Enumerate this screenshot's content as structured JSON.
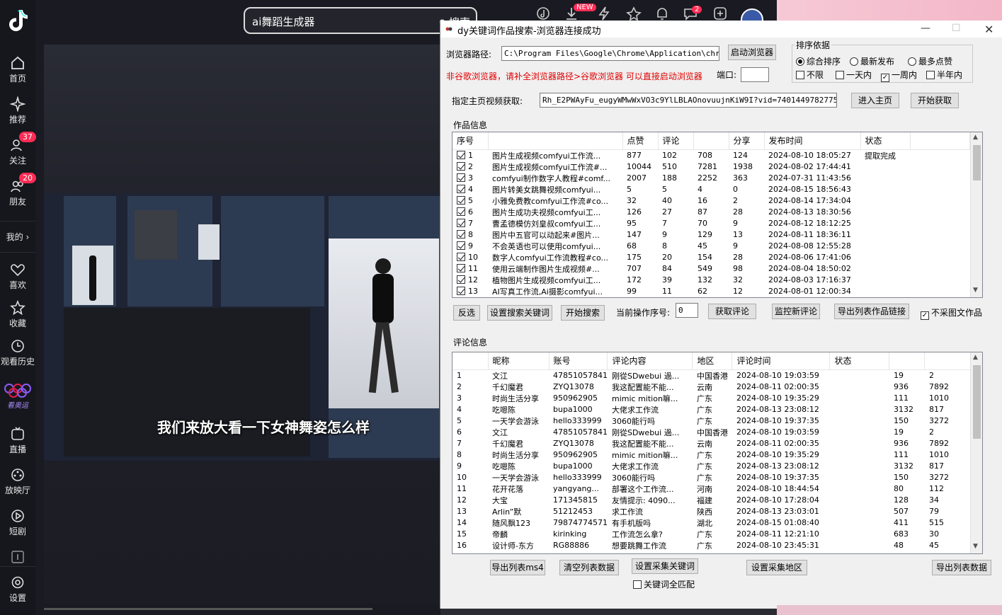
{
  "sidebar": {
    "items": [
      {
        "label": "首页"
      },
      {
        "label": "推荐"
      },
      {
        "label": "关注",
        "badge": "37"
      },
      {
        "label": "朋友",
        "badge": "20"
      },
      {
        "label": "我的 ›"
      },
      {
        "label": "喜欢"
      },
      {
        "label": "收藏"
      },
      {
        "label": "观看历史"
      },
      {
        "label": "看奥运"
      },
      {
        "label": "直播"
      },
      {
        "label": "放映厅"
      },
      {
        "label": "短剧"
      },
      {
        "label": "设置"
      }
    ]
  },
  "topbar": {
    "search_value": "ai舞蹈生成器",
    "search_button": "搜索",
    "download_badge": "NEW",
    "message_badge": "2"
  },
  "video": {
    "subtitle": "我们来放大看一下女神舞姿怎么样"
  },
  "window": {
    "title": "dy关键词作品搜索-浏览器连接成功",
    "browser_path_label": "浏览器路径:",
    "browser_path_value": "C:\\Program Files\\Google\\Chrome\\Application\\chrome.e",
    "launch_browser_button": "启动浏览器",
    "red_note": "非谷歌浏览器，请补全浏览器路径>谷歌浏览器 可以直接启动浏览器",
    "port_label": "端口:",
    "port_value": "",
    "sort_group_label": "排序依据",
    "sort_options": [
      {
        "label": "综合排序",
        "checked": true
      },
      {
        "label": "最新发布",
        "checked": false
      },
      {
        "label": "最多点赞",
        "checked": false
      }
    ],
    "time_options": [
      {
        "label": "不限",
        "checked": false
      },
      {
        "label": "一天内",
        "checked": false
      },
      {
        "label": "一周内",
        "checked": true
      },
      {
        "label": "半年内",
        "checked": false
      }
    ],
    "homepage_label": "指定主页视频获取:",
    "homepage_value": "Rh_E2PWAyFu_eugyWMwWxVO3c9YlLBLAOnovuujnKiW9I?vid=7401449782775958784",
    "enter_home_button": "进入主页",
    "start_fetch_button": "开始获取",
    "works_group_label": "作品信息",
    "works_columns": [
      "序号",
      "",
      "点赞",
      "评论",
      "",
      "分享",
      "发布时间",
      "状态",
      ""
    ],
    "works_rows": [
      [
        "1",
        "图片生成视频comfyui工作流...",
        "877",
        "102",
        "708",
        "124",
        "2024-08-10 18:05:27",
        "提取完成"
      ],
      [
        "2",
        "图片生成视频comfyui工作流#...",
        "10044",
        "510",
        "7281",
        "1938",
        "2024-08-02 17:44:41",
        ""
      ],
      [
        "3",
        "comfyui制作数字人教程#comf...",
        "2007",
        "188",
        "2252",
        "363",
        "2024-07-31 11:43:56",
        ""
      ],
      [
        "4",
        "图片转美女跳舞视频comfyui...",
        "5",
        "5",
        "4",
        "0",
        "2024-08-15 18:56:43",
        ""
      ],
      [
        "5",
        "小雅免费教comfyui工作流#co...",
        "32",
        "40",
        "16",
        "2",
        "2024-08-14 17:34:04",
        ""
      ],
      [
        "6",
        "图片生成功夫视频comfyui工...",
        "126",
        "27",
        "87",
        "28",
        "2024-08-13 18:30:56",
        ""
      ],
      [
        "7",
        "曹孟德模仿刘皇叔comfyui工...",
        "95",
        "7",
        "70",
        "9",
        "2024-08-12 18:12:25",
        ""
      ],
      [
        "8",
        "图片中五官可以动起来#图片...",
        "147",
        "9",
        "129",
        "13",
        "2024-08-11 18:36:11",
        ""
      ],
      [
        "9",
        "不会英语也可以使用comfyui...",
        "68",
        "8",
        "45",
        "9",
        "2024-08-08 12:55:28",
        ""
      ],
      [
        "10",
        "数字人comfyui工作流教程#co...",
        "175",
        "20",
        "154",
        "28",
        "2024-08-06 17:41:06",
        ""
      ],
      [
        "11",
        "使用云端制作图片生成视频#...",
        "707",
        "84",
        "549",
        "98",
        "2024-08-04 18:50:02",
        ""
      ],
      [
        "12",
        "植物图片生成视频comfyui工...",
        "172",
        "39",
        "132",
        "32",
        "2024-08-03 17:16:37",
        ""
      ],
      [
        "13",
        "AI写真工作流,Ai摄影comfyui...",
        "99",
        "11",
        "62",
        "12",
        "2024-08-01 12:00:34",
        ""
      ]
    ],
    "invert_button": "反选",
    "set_keyword_button": "设置搜索关键词",
    "start_search_button": "开始搜索",
    "current_index_label": "当前操作序号:",
    "current_index_value": "0",
    "get_comments_button": "获取评论",
    "monitor_button": "监控新评论",
    "export_links_button": "导出列表作品链接",
    "no_image_check_label": "不采图文作品",
    "comments_group_label": "评论信息",
    "comments_columns": [
      "",
      "昵称",
      "账号",
      "评论内容",
      "地区",
      "评论时间",
      "状态",
      "",
      ""
    ],
    "comments_rows": [
      [
        "1",
        "文江",
        "47851057841",
        "刚從SDwebui 過...",
        "中国香港",
        "2024-08-10 19:03:59",
        "",
        "19",
        "2"
      ],
      [
        "2",
        "千幻魔君",
        "ZYQ13078",
        "我这配置能不能...",
        "云南",
        "2024-08-11 02:00:35",
        "",
        "936",
        "7892"
      ],
      [
        "3",
        "时尚生活分享",
        "950962905",
        "mimic mition嘛...",
        "广东",
        "2024-08-10 19:35:29",
        "",
        "111",
        "1010"
      ],
      [
        "4",
        "吃嗯陈",
        "bupa1000",
        "大佬求工作流",
        "广东",
        "2024-08-13 23:08:12",
        "",
        "3132",
        "817"
      ],
      [
        "5",
        "一天学会游泳",
        "hello333999",
        "3060能行吗",
        "广东",
        "2024-08-10 19:37:35",
        "",
        "150",
        "3272"
      ],
      [
        "6",
        "文江",
        "47851057841",
        "刚從SDwebui 過...",
        "中国香港",
        "2024-08-10 19:03:59",
        "",
        "19",
        "2"
      ],
      [
        "7",
        "千幻魔君",
        "ZYQ13078",
        "我这配置能不能...",
        "云南",
        "2024-08-11 02:00:35",
        "",
        "936",
        "7892"
      ],
      [
        "8",
        "时尚生活分享",
        "950962905",
        "mimic mition嘛...",
        "广东",
        "2024-08-10 19:35:29",
        "",
        "111",
        "1010"
      ],
      [
        "9",
        "吃嗯陈",
        "bupa1000",
        "大佬求工作流",
        "广东",
        "2024-08-13 23:08:12",
        "",
        "3132",
        "817"
      ],
      [
        "10",
        "一天学会游泳",
        "hello333999",
        "3060能行吗",
        "广东",
        "2024-08-10 19:37:35",
        "",
        "150",
        "3272"
      ],
      [
        "11",
        "花开花落",
        "yangyang...",
        "部署这个工作流...",
        "河南",
        "2024-08-10 18:44:54",
        "",
        "80",
        "112"
      ],
      [
        "12",
        "大宝",
        "171345815",
        "友情提示: 4090...",
        "福建",
        "2024-08-10 17:28:04",
        "",
        "128",
        "34"
      ],
      [
        "13",
        "Arlin”默",
        "51212453",
        "求工作流",
        "陕西",
        "2024-08-13 23:03:01",
        "",
        "507",
        "79"
      ],
      [
        "14",
        "随风飘123",
        "79874774571",
        "有手机版吗",
        "湖北",
        "2024-08-15 01:08:40",
        "",
        "411",
        "515"
      ],
      [
        "15",
        "帝麟",
        "kirinking",
        "工作流怎么拿?",
        "广东",
        "2024-08-11 12:21:10",
        "",
        "683",
        "30"
      ],
      [
        "16",
        "设计师-东方",
        "RG88886",
        "想要跳舞工作流",
        "广东",
        "2024-08-10 23:45:31",
        "",
        "48",
        "45"
      ]
    ],
    "export_ms4_button": "导出列表ms4",
    "clear_list_button": "清空列表数据",
    "set_collect_keyword_button": "设置采集关键词",
    "set_region_button": "设置采集地区",
    "export_list_button": "导出列表数据",
    "keyword_match_label": "关键词全匹配"
  }
}
